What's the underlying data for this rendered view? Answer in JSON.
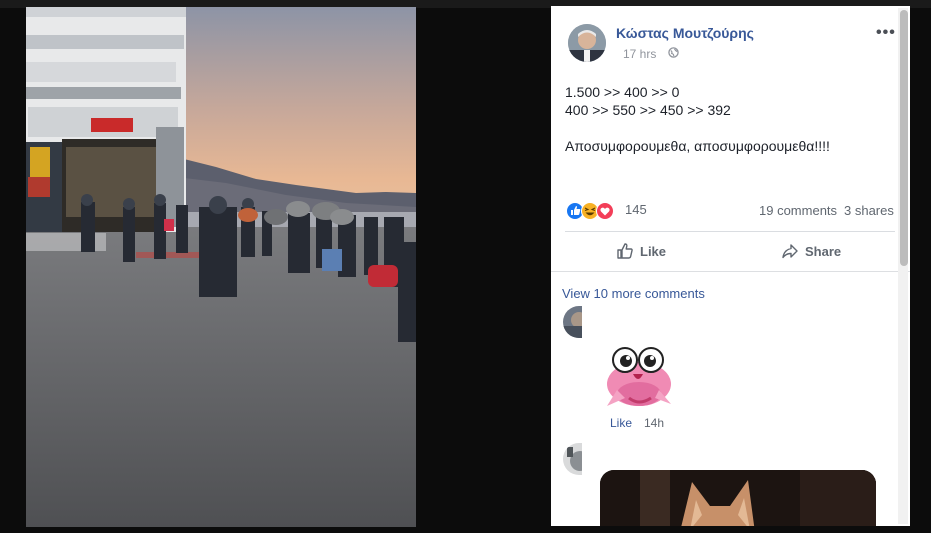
{
  "post": {
    "author": "Κώστας Μουτζούρης",
    "time": "17 hrs",
    "more_label": "•••",
    "text_lines": [
      "1.500 >> 400 >> 0",
      "400 >> 550 >> 450 >> 392",
      "",
      "Αποσυμφορουμεθα, αποσυμφορουμεθα!!!!"
    ],
    "reaction_count": "145",
    "comments_count": "19 comments",
    "shares_count": "3 shares",
    "like_label": "Like",
    "share_label": "Share"
  },
  "comments": {
    "view_more": "View 10 more comments",
    "items": [
      {
        "like_label": "Like",
        "time": "14h"
      }
    ]
  },
  "colors": {
    "link": "#385898",
    "like_blue": "#1877f2",
    "love_red": "#f33e58",
    "haha_yellow": "#f7b125"
  },
  "icons": [
    "globe-icon",
    "like-reaction-icon",
    "haha-reaction-icon",
    "love-reaction-icon",
    "thumbs-up-icon",
    "share-arrow-icon",
    "more-options-icon"
  ]
}
